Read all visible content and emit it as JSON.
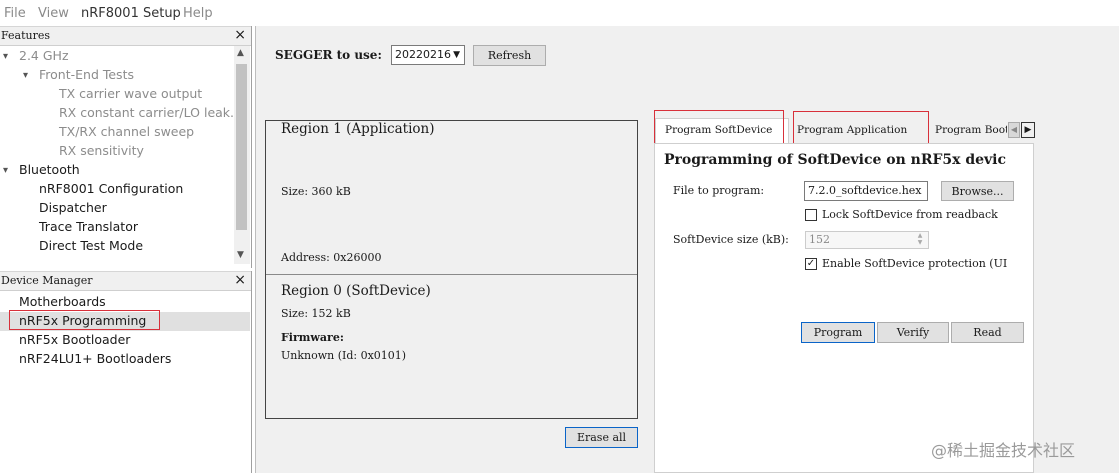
{
  "menu": [
    "File",
    "View",
    "nRF8001 Setup",
    "Help"
  ],
  "features": {
    "title": "Features",
    "close": "×",
    "items": [
      {
        "label": "2.4 GHz",
        "indent": 0,
        "chevron": "▾",
        "dim": true
      },
      {
        "label": "Front-End Tests",
        "indent": 1,
        "chevron": "▾",
        "dim": true
      },
      {
        "label": "TX carrier wave output",
        "indent": 2,
        "dim": true
      },
      {
        "label": "RX constant carrier/LO leak...",
        "indent": 2,
        "dim": true
      },
      {
        "label": "TX/RX channel sweep",
        "indent": 2,
        "dim": true
      },
      {
        "label": "RX sensitivity",
        "indent": 2,
        "dim": true
      },
      {
        "label": "Bluetooth",
        "indent": 0,
        "chevron": "▾",
        "dim": false
      },
      {
        "label": "nRF8001 Configuration",
        "indent": 1,
        "dim": false
      },
      {
        "label": "Dispatcher",
        "indent": 1,
        "dim": false
      },
      {
        "label": "Trace Translator",
        "indent": 1,
        "dim": false
      },
      {
        "label": "Direct Test Mode",
        "indent": 1,
        "dim": false
      }
    ]
  },
  "device_manager": {
    "title": "Device Manager",
    "close": "×",
    "items": [
      "Motherboards",
      "nRF5x Programming",
      "nRF5x Bootloader",
      "nRF24LU1+ Bootloaders"
    ],
    "selected": "nRF5x Programming"
  },
  "main": {
    "segger_label": "SEGGER to use:",
    "segger_value": "20220216",
    "refresh_label": "Refresh",
    "region1": {
      "title": "Region 1 (Application)",
      "size": "Size: 360 kB",
      "address": "Address:  0x26000"
    },
    "region0": {
      "title": "Region 0 (SoftDevice)",
      "size": "Size: 152 kB",
      "firmware_label": "Firmware:",
      "firmware_value": "Unknown (Id: 0x0101)"
    },
    "erase_label": "Erase all"
  },
  "tabs": {
    "items": [
      "Program SoftDevice",
      "Program Application",
      "Program Boot"
    ],
    "active": "Program SoftDevice",
    "page_title": "Programming of SoftDevice on nRF5x devic",
    "file_label": "File to program:",
    "file_value": "7.2.0_softdevice.hex",
    "browse_label": "Browse...",
    "lock_label": "Lock SoftDevice from readback",
    "lock_checked": false,
    "size_label": "SoftDevice size (kB):",
    "size_value": "152",
    "protect_label": "Enable SoftDevice protection (UI",
    "protect_checked": true,
    "program_label": "Program",
    "verify_label": "Verify",
    "read_label": "Read"
  },
  "watermark": "@稀土掘金技术社区",
  "colors": {
    "highlight": "#d8303a",
    "focus": "#0a64c8"
  }
}
